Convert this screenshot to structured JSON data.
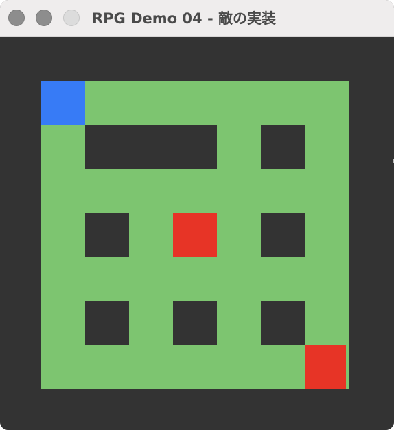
{
  "window": {
    "title": "RPG Demo 04 - 敵の実装",
    "buttons": [
      "close",
      "minimize",
      "maximize"
    ]
  },
  "colors": {
    "background": "#333333",
    "floor": "#7dc570",
    "wall": "#333333",
    "player": "#377bf6",
    "enemy": "#e73426",
    "titlebar": "#efeded"
  },
  "map": {
    "grid_size": 7,
    "walls": [
      {
        "col": 1,
        "row": 1,
        "w": 3,
        "h": 1
      },
      {
        "col": 5,
        "row": 1,
        "w": 1,
        "h": 1
      },
      {
        "col": 1,
        "row": 3,
        "w": 1,
        "h": 1
      },
      {
        "col": 5,
        "row": 3,
        "w": 1,
        "h": 1
      },
      {
        "col": 1,
        "row": 5,
        "w": 1,
        "h": 1
      },
      {
        "col": 3,
        "row": 5,
        "w": 1,
        "h": 1
      },
      {
        "col": 5,
        "row": 5,
        "w": 1,
        "h": 1
      }
    ],
    "player": {
      "col": 0,
      "row": 0
    },
    "enemies": [
      {
        "col": 3,
        "row": 3
      },
      {
        "col": 6,
        "row": 6
      }
    ]
  }
}
